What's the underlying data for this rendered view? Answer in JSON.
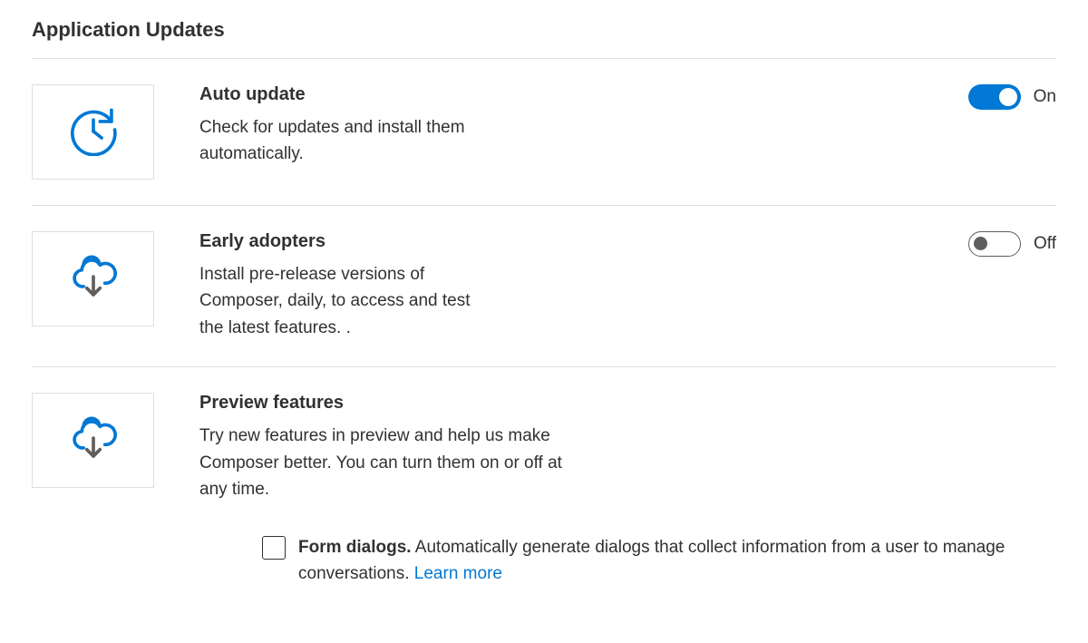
{
  "section_title": "Application Updates",
  "colors": {
    "brand": "#0078d4",
    "border": "#e1dfdd",
    "text": "#323130",
    "muted": "#605e5c"
  },
  "settings": {
    "auto_update": {
      "title": "Auto update",
      "desc": "Check for updates and install them automatically.",
      "toggle": {
        "state": "on",
        "label": "On"
      }
    },
    "early_adopters": {
      "title": "Early adopters",
      "desc": "Install pre-release versions of Composer, daily, to access and test the latest features. .",
      "toggle": {
        "state": "off",
        "label": "Off"
      }
    },
    "preview_features": {
      "title": "Preview features",
      "desc": "Try new features in preview and help us make Composer better. You can turn them on or off at any time.",
      "checkbox": {
        "title": "Form dialogs.",
        "desc": " Automatically generate dialogs that collect information from a user to manage conversations. ",
        "link": "Learn more",
        "checked": false
      }
    }
  }
}
